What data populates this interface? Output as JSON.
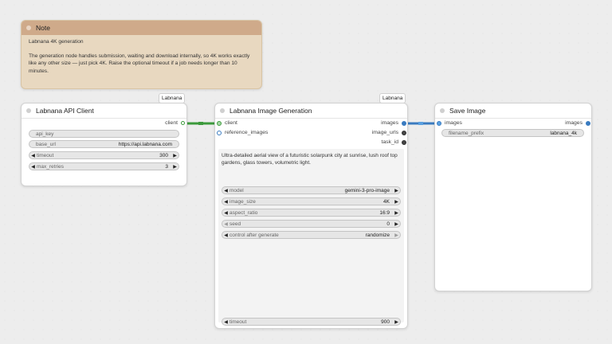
{
  "note": {
    "title": "Note",
    "heading": "Labnana 4K generation",
    "body": "The generation node handles submission, waiting and download internally, so 4K works exactly like any other size — just pick 4K. Raise the optional timeout if a job needs longer than 10 minutes."
  },
  "api_client": {
    "badge": "Labnana",
    "title": "Labnana API Client",
    "output_client": "client",
    "widgets": [
      {
        "label": "api_key",
        "value": ""
      },
      {
        "label": "base_url",
        "value": "https://api.labnana.com"
      },
      {
        "label": "timeout",
        "value": "300"
      },
      {
        "label": "max_retries",
        "value": "3"
      }
    ]
  },
  "image_gen": {
    "badge": "Labnana",
    "title": "Labnana Image Generation",
    "inputs": [
      "client",
      "reference_images"
    ],
    "outputs": [
      "images",
      "image_urls",
      "task_id"
    ],
    "prompt": "Ultra-detailed aerial view of a futuristic solarpunk city at sunrise, lush roof top gardens, glass towers, volumetric light.",
    "widgets": [
      {
        "label": "model",
        "value": "gemini-3-pro-image"
      },
      {
        "label": "image_size",
        "value": "4K"
      },
      {
        "label": "aspect_ratio",
        "value": "16:9"
      },
      {
        "label": "seed",
        "value": "0"
      },
      {
        "label": "control after generate",
        "value": "randomize"
      }
    ],
    "timeout_widget": {
      "label": "timeout",
      "value": "900"
    }
  },
  "save_image": {
    "title": "Save Image",
    "input_images": "images",
    "output_images": "images",
    "widgets": [
      {
        "label": "filename_prefix",
        "value": "labnana_4k"
      }
    ]
  },
  "colors": {
    "link_client": "#3c9a3c",
    "link_images": "#3a7bc0",
    "note_header": "#cfaa8a",
    "note_body": "#e8d8c0"
  }
}
